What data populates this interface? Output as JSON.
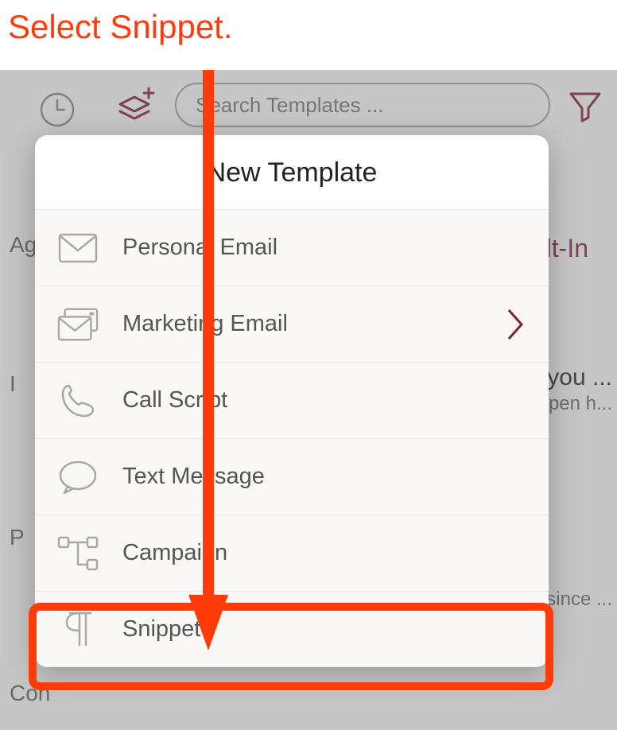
{
  "annotation": {
    "label": "Select Snippet."
  },
  "topbar": {
    "sidebar_label_1": "Ag",
    "search_placeholder": "Search Templates ..."
  },
  "sidebar": {
    "items": [
      "Ag",
      "I",
      "P",
      "Con"
    ]
  },
  "right_content": {
    "builtin_tab": "lt-In",
    "item1_line1": "you ...",
    "item1_line2": "pen h...",
    "item2": "since ..."
  },
  "popover": {
    "title": "New Template",
    "items": [
      {
        "label": "Personal Email",
        "icon": "envelope",
        "chevron": false
      },
      {
        "label": "Marketing Email",
        "icon": "envelopes",
        "chevron": true
      },
      {
        "label": "Call Script",
        "icon": "phone",
        "chevron": false
      },
      {
        "label": "Text Message",
        "icon": "speech",
        "chevron": false
      },
      {
        "label": "Campaign",
        "icon": "workflow",
        "chevron": false
      },
      {
        "label": "Snippet",
        "icon": "pilcrow",
        "chevron": false
      }
    ]
  }
}
